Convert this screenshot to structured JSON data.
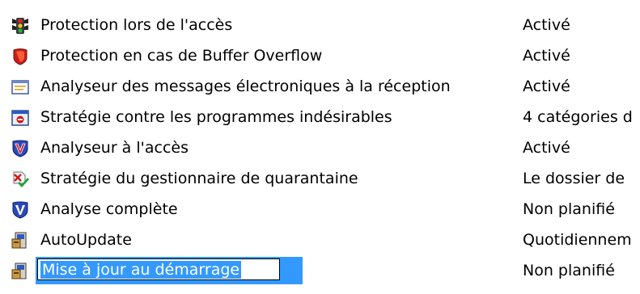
{
  "rows": [
    {
      "icon": "traffic-light-icon",
      "name": "Protection lors de l'accès",
      "status": "Activé"
    },
    {
      "icon": "red-shield-icon",
      "name": "Protection en cas de Buffer Overflow",
      "status": "Activé"
    },
    {
      "icon": "email-scanner-icon",
      "name": "Analyseur des messages électroniques à la réception",
      "status": "Activé"
    },
    {
      "icon": "unwanted-programs-icon",
      "name": "Stratégie contre les programmes indésirables",
      "status": "4 catégories d"
    },
    {
      "icon": "mcafee-shield-icon",
      "name": "Analyseur à l'accès",
      "status": "Activé"
    },
    {
      "icon": "quarantine-icon",
      "name": "Stratégie du gestionnaire de quarantaine",
      "status": "Le dossier de"
    },
    {
      "icon": "scan-shield-icon",
      "name": "Analyse complète",
      "status": "Non planifié"
    },
    {
      "icon": "autoupdate-icon",
      "name": "AutoUpdate",
      "status": "Quotidiennem"
    },
    {
      "icon": "autoupdate-icon",
      "name": "Mise à jour au démarrage",
      "status": "Non planifié",
      "editing": true
    }
  ],
  "colors": {
    "selection": "#3399ff",
    "text": "#000000",
    "background": "#ffffff"
  }
}
